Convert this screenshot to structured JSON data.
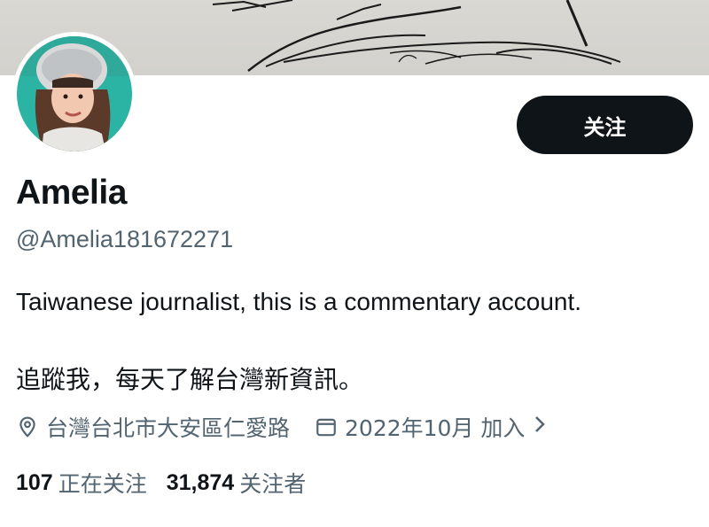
{
  "profile": {
    "name": "Amelia",
    "handle": "@Amelia181672271",
    "bio_line1": "Taiwanese journalist, this is a commentary account.",
    "bio_line2": "追蹤我，每天了解台灣新資訊。",
    "location": "台灣台北市大安區仁愛路",
    "joined": "2022年10月 加入"
  },
  "actions": {
    "follow_label": "关注"
  },
  "stats": {
    "following_count": "107",
    "following_label": "正在关注",
    "followers_count": "31,874",
    "followers_label": "关注者"
  },
  "icons": {
    "location": "location-pin-icon",
    "calendar": "calendar-icon",
    "chevron": "chevron-right-icon"
  },
  "colors": {
    "primary_text": "#0f1419",
    "secondary_text": "#536471",
    "button_bg": "#0f1419",
    "avatar_bg": "#2bb3a3"
  }
}
